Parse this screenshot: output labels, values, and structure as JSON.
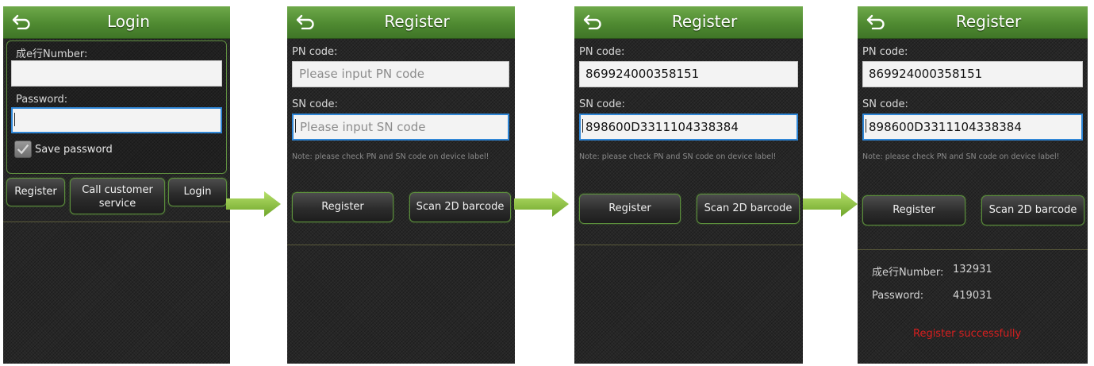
{
  "login": {
    "title": "Login",
    "number_label": "成e行Number:",
    "number_value": "",
    "password_label": "Password:",
    "password_value": "",
    "save_password_label": "Save password",
    "save_password_checked": true,
    "buttons": {
      "register": "Register",
      "call_service": "Call customer service",
      "login": "Login"
    }
  },
  "reg1": {
    "title": "Register",
    "pn_label": "PN code:",
    "pn_placeholder": "Please input PN code",
    "sn_label": "SN code:",
    "sn_placeholder": "Please input SN code",
    "note": "Note: please check PN and SN code on device label!",
    "register_button": "Register",
    "scan_button": "Scan 2D barcode"
  },
  "reg2": {
    "title": "Register",
    "pn_label": "PN code:",
    "pn_value": "869924000358151",
    "sn_label": "SN code:",
    "sn_value": "898600D3311104338384",
    "note": "Note: please check PN and SN code on device label!",
    "register_button": "Register",
    "scan_button": "Scan 2D barcode"
  },
  "reg3": {
    "title": "Register",
    "pn_label": "PN code:",
    "pn_value": "869924000358151",
    "sn_label": "SN code:",
    "sn_value": "898600D3311104338384",
    "note": "Note: please check PN and SN code on device label!",
    "register_button": "Register",
    "scan_button": "Scan 2D barcode",
    "result": {
      "number_label": "成e行Number:",
      "number_value": "132931",
      "password_label": "Password:",
      "password_value": "419031",
      "status": "Register successfully"
    }
  },
  "icons": [
    "back-arrow-icon",
    "checkmark-icon",
    "right-arrow-icon"
  ],
  "colors": {
    "titlebar_green": "#4f8a31",
    "focus_blue": "#2f86d6",
    "success_red": "#d81f1f",
    "flow_arrow_green": "#8cc43c"
  }
}
